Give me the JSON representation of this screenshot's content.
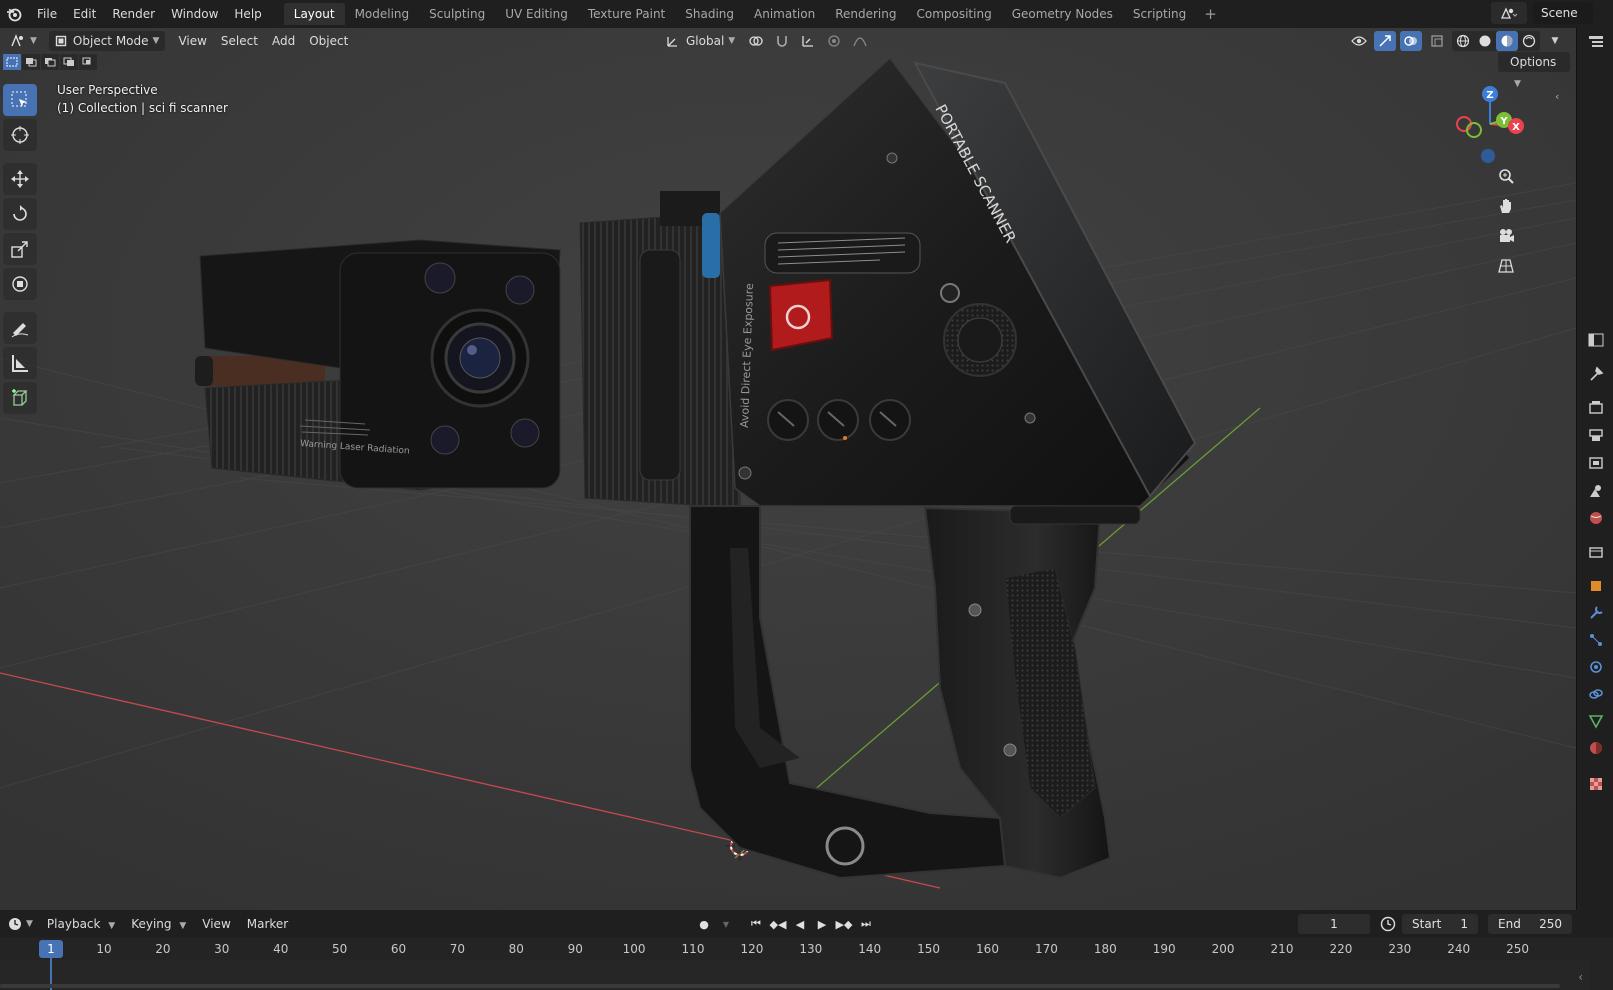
{
  "top_menu": [
    "File",
    "Edit",
    "Render",
    "Window",
    "Help"
  ],
  "workspace_tabs": [
    {
      "label": "Layout",
      "active": true
    },
    {
      "label": "Modeling"
    },
    {
      "label": "Sculpting"
    },
    {
      "label": "UV Editing"
    },
    {
      "label": "Texture Paint"
    },
    {
      "label": "Shading"
    },
    {
      "label": "Animation"
    },
    {
      "label": "Rendering"
    },
    {
      "label": "Compositing"
    },
    {
      "label": "Geometry Nodes"
    },
    {
      "label": "Scripting"
    }
  ],
  "add_workspace_label": "+",
  "scene": {
    "name": "Scene"
  },
  "viewport_header": {
    "mode": "Object Mode",
    "menus": [
      "View",
      "Select",
      "Add",
      "Object"
    ],
    "orientation": "Global",
    "options_label": "Options"
  },
  "viewport_overlay": {
    "perspective": "User Perspective",
    "collection": "(1) Collection | sci fi scanner"
  },
  "gizmo": {
    "z": "Z",
    "y": "Y",
    "x": "X"
  },
  "model_text": {
    "title": "PORTABLE SCANNER",
    "side_label": "Avoid Direct Eye Exposure",
    "warning": "Warning Laser Radiation"
  },
  "timeline": {
    "menus": [
      "Playback",
      "Keying",
      "View",
      "Marker"
    ],
    "current_frame": "1",
    "start_label": "Start",
    "start_value": "1",
    "end_label": "End",
    "end_value": "250",
    "ruler_ticks": [
      "10",
      "20",
      "30",
      "40",
      "50",
      "60",
      "70",
      "80",
      "90",
      "100",
      "110",
      "120",
      "130",
      "140",
      "150",
      "160",
      "170",
      "180",
      "190",
      "200",
      "210",
      "220",
      "230",
      "240",
      "250"
    ],
    "playhead_label": "1"
  },
  "colors": {
    "accent": "#4772b3",
    "axis_x": "#e8434f",
    "axis_y": "#7cbf36",
    "axis_z": "#3c7fd6",
    "red_switch": "#b11b1b"
  }
}
